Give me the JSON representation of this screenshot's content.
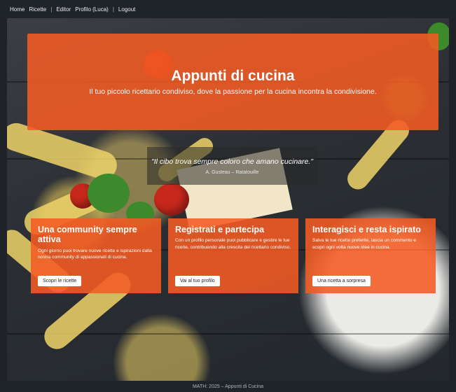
{
  "navbar": {
    "items": [
      {
        "label": "Home"
      },
      {
        "label": "Ricette"
      },
      {
        "label": "Editor"
      },
      {
        "label": "Profilo (Luca)"
      },
      {
        "label": "Logout"
      }
    ],
    "separator": "|"
  },
  "banner": {
    "title": "Appunti di cucina",
    "subtitle": "Il tuo piccolo ricettario condiviso, dove la passione per la cucina incontra la condivisione."
  },
  "quote": {
    "text": "\"Il cibo trova sempre coloro che amano cucinare.\"",
    "author": "A. Gusteau – Ratatouille"
  },
  "cards": [
    {
      "title": "Una community sempre attiva",
      "body": "Ogni giorno puoi trovare nuove ricette e ispirazioni dalla nostra community di appassionati di cucina.",
      "button": "Scopri le ricette"
    },
    {
      "title": "Registrati e partecipa",
      "body": "Con un profilo personale puoi pubblicare e gestire le tue ricette, contribuendo alla crescita del ricettario condiviso.",
      "button": "Vai al tuo profilo"
    },
    {
      "title": "Interagisci e resta ispirato",
      "body": "Salva le tue ricette preferite, lascia un commento e scopri ogni volta nuove idee in cucina.",
      "button": "Una ricetta a sorpresa"
    }
  ],
  "footer": {
    "text": "MATH: 2025 – Appunti di Cucina"
  },
  "colors": {
    "accent": "#f45b23",
    "navbar": "#1f2428"
  }
}
